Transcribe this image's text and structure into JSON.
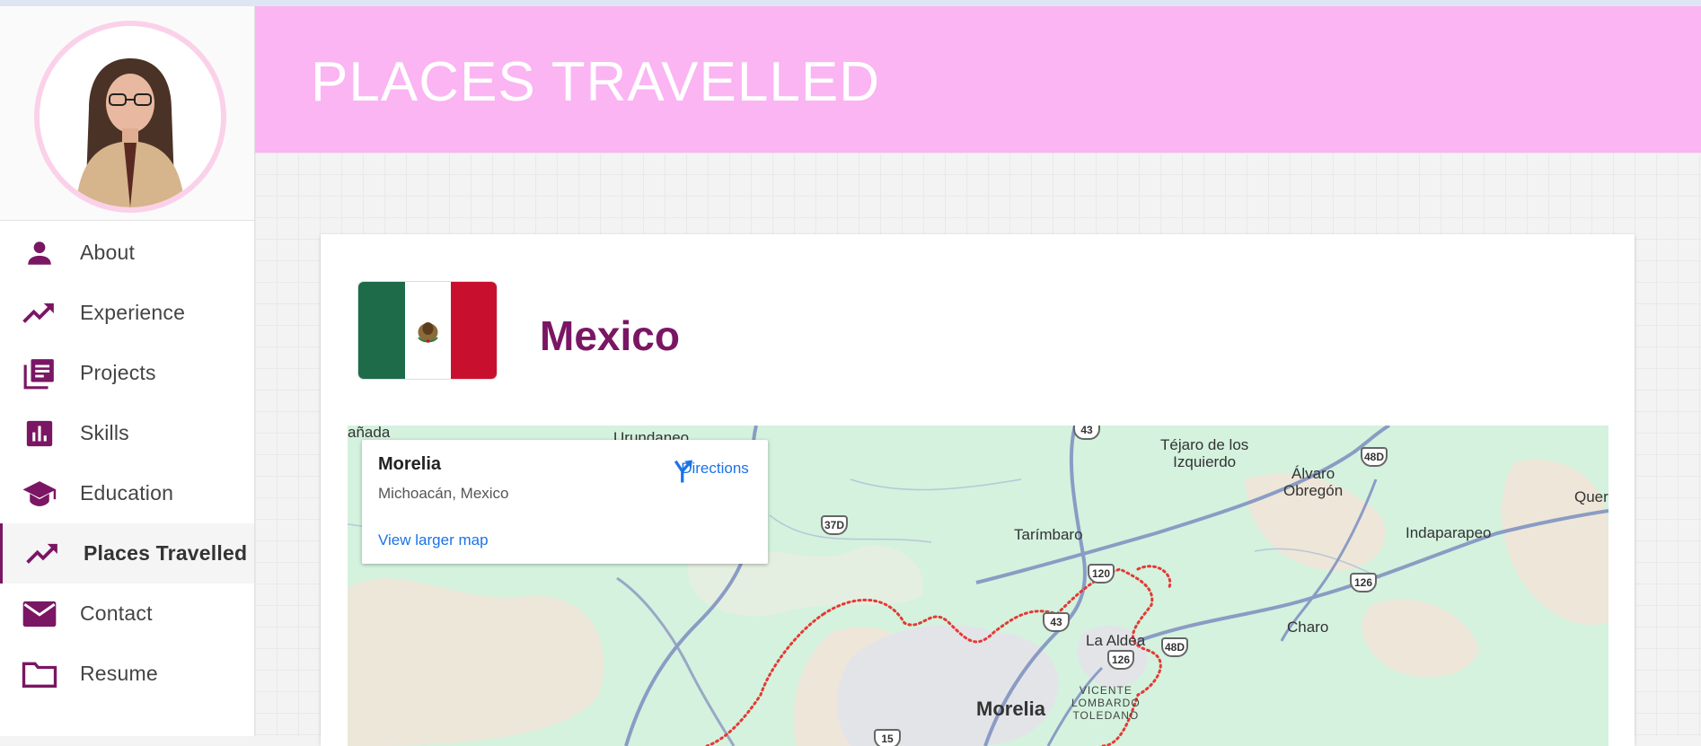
{
  "header": {
    "title": "PLACES TRAVELLED"
  },
  "sidebar": {
    "items": [
      {
        "label": "About",
        "icon": "person-icon"
      },
      {
        "label": "Experience",
        "icon": "trending-up-icon"
      },
      {
        "label": "Projects",
        "icon": "article-stack-icon"
      },
      {
        "label": "Skills",
        "icon": "bar-chart-icon"
      },
      {
        "label": "Education",
        "icon": "graduation-cap-icon"
      },
      {
        "label": "Places Travelled",
        "icon": "trending-up-icon",
        "active": true
      },
      {
        "label": "Contact",
        "icon": "mail-icon"
      },
      {
        "label": "Resume",
        "icon": "folder-icon"
      }
    ]
  },
  "main": {
    "country": "Mexico",
    "map": {
      "place_name": "Morelia",
      "place_address": "Michoacán, Mexico",
      "directions_label": "Directions",
      "larger_map_label": "View larger map",
      "labels": {
        "anada": "añada",
        "urundaneo": "Urundaneo",
        "tejaro": "Téjaro de los\nIzquierdo",
        "alvaro": "Álvaro\nObregón",
        "quer": "Quer",
        "tarimbaro": "Tarímbaro",
        "indaparapeo": "Indaparapeo",
        "charo": "Charo",
        "la_aldea": "La Aldea",
        "vicente": "VICENTE\nLOMBARDO\nTOLEDANO",
        "morelia": "Morelia"
      },
      "shields": [
        "43",
        "48D",
        "37D",
        "120",
        "126",
        "43",
        "126",
        "48D",
        "15"
      ]
    }
  },
  "colors": {
    "accent": "#7a1664",
    "header_bg": "#fab5f2",
    "avatar_ring": "#fbd1ea",
    "map_bg": "#d4f2de",
    "link": "#1a73e8"
  }
}
